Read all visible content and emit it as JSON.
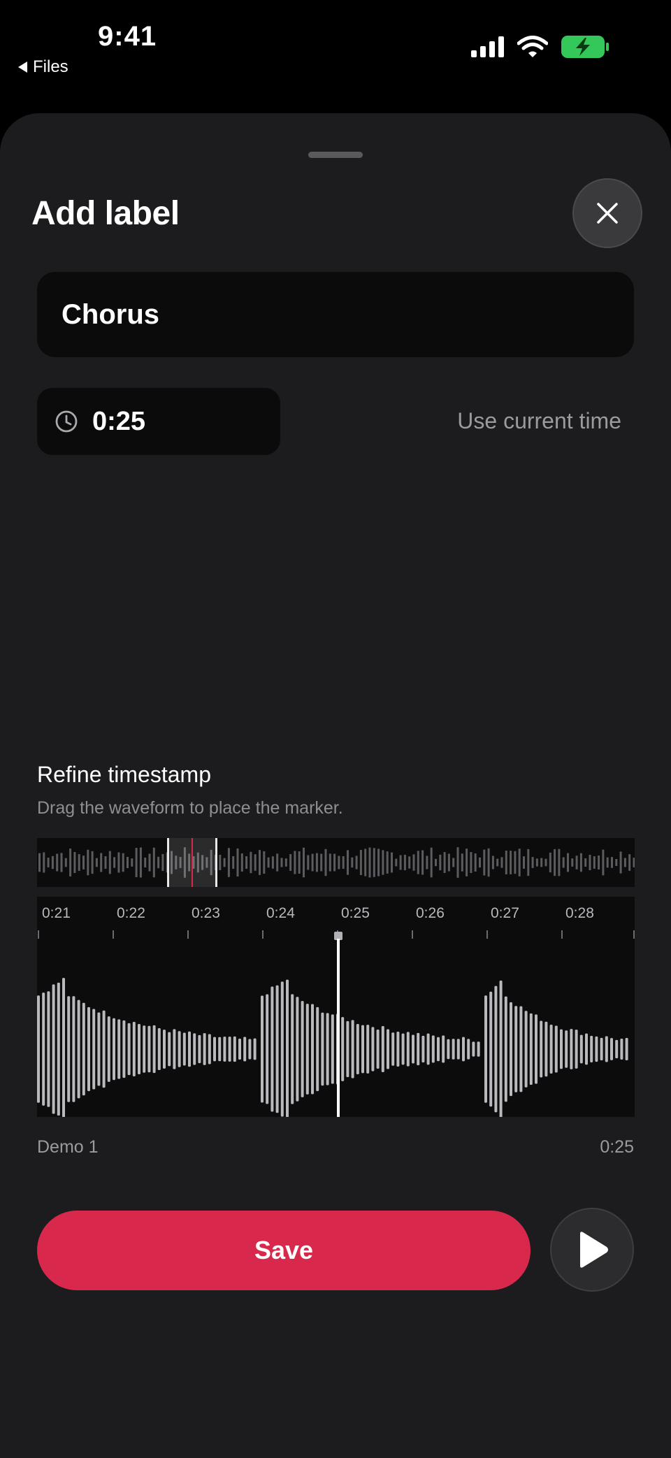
{
  "status_bar": {
    "time": "9:41",
    "back_label": "Files",
    "battery_color": "#34c759"
  },
  "sheet": {
    "title": "Add label",
    "close_icon": "close-icon"
  },
  "label_field": {
    "value": "Chorus"
  },
  "timestamp": {
    "value": "0:25",
    "use_current_label": "Use current time"
  },
  "refine": {
    "title": "Refine timestamp",
    "subtitle": "Drag the waveform to place the marker.",
    "tick_labels": [
      "0:21",
      "0:22",
      "0:23",
      "0:24",
      "0:25",
      "0:26",
      "0:27",
      "0:28"
    ]
  },
  "track": {
    "name": "Demo 1",
    "time": "0:25"
  },
  "actions": {
    "save_label": "Save",
    "accent_color": "#d8294d"
  }
}
